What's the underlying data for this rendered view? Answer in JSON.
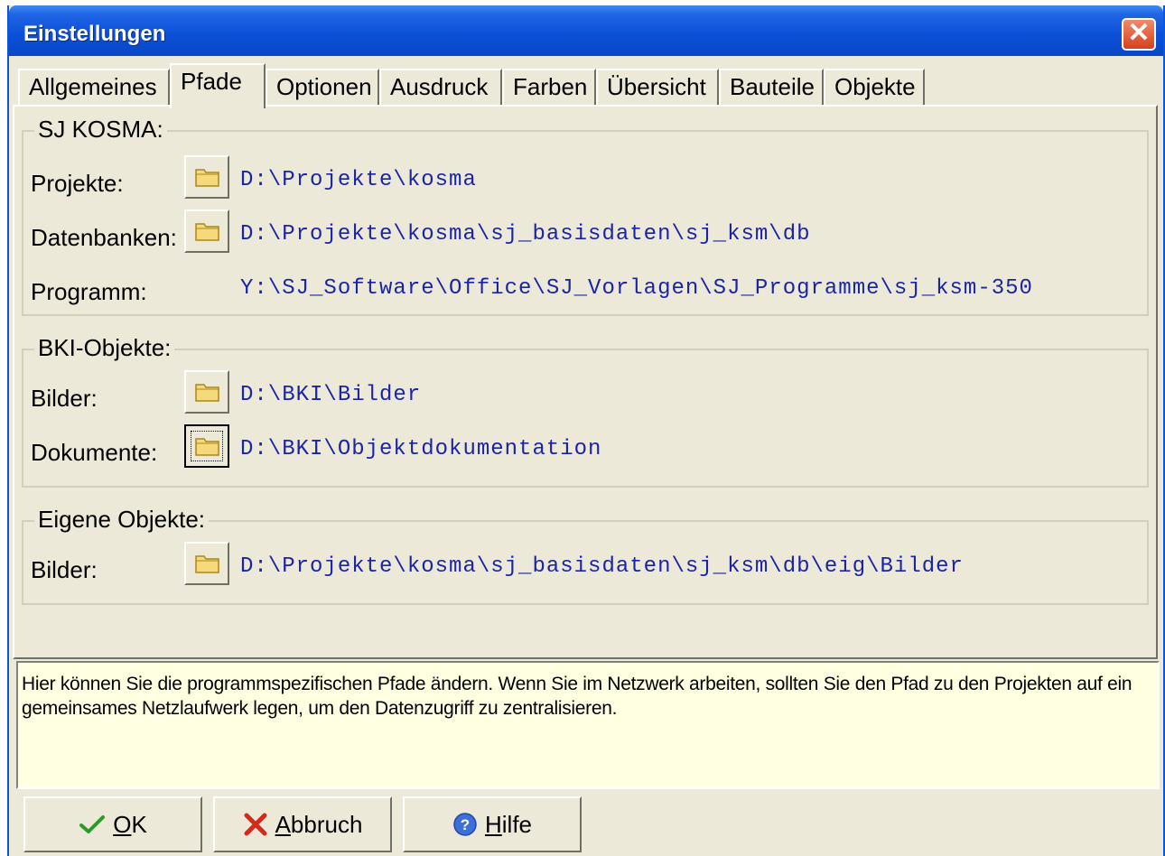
{
  "window": {
    "title": "Einstellungen"
  },
  "tabs": [
    {
      "label": "Allgemeines"
    },
    {
      "label": "Pfade"
    },
    {
      "label": "Optionen"
    },
    {
      "label": "Ausdruck"
    },
    {
      "label": "Farben"
    },
    {
      "label": "Übersicht"
    },
    {
      "label": "Bauteile"
    },
    {
      "label": "Objekte"
    }
  ],
  "active_tab": "Pfade",
  "groups": {
    "kosma": {
      "title": "SJ KOSMA:",
      "rows": [
        {
          "label": "Projekte:",
          "path": "D:\\Projekte\\kosma",
          "has_button": true
        },
        {
          "label": "Datenbanken:",
          "path": "D:\\Projekte\\kosma\\sj_basisdaten\\sj_ksm\\db",
          "has_button": true
        },
        {
          "label": "Programm:",
          "path": "Y:\\SJ_Software\\Office\\SJ_Vorlagen\\SJ_Programme\\sj_ksm-350",
          "has_button": false
        }
      ]
    },
    "bki": {
      "title": "BKI-Objekte:",
      "rows": [
        {
          "label": "Bilder:",
          "path": "D:\\BKI\\Bilder",
          "has_button": true
        },
        {
          "label": "Dokumente:",
          "path": "D:\\BKI\\Objektdokumentation",
          "has_button": true
        }
      ]
    },
    "eigene": {
      "title": "Eigene Objekte:",
      "rows": [
        {
          "label": "Bilder:",
          "path": "D:\\Projekte\\kosma\\sj_basisdaten\\sj_ksm\\db\\eig\\Bilder",
          "has_button": true
        }
      ]
    }
  },
  "info_text": "Hier können Sie die programmspezifischen Pfade ändern. Wenn Sie im Netzwerk arbeiten, sollten Sie den Pfad zu den Projekten auf ein gemeinsames Netzlaufwerk legen, um den Datenzugriff zu zentralisieren.",
  "buttons": {
    "ok": {
      "mnemonic": "O",
      "rest": "K",
      "icon": "checkmark-icon",
      "color": "#2a9a2a"
    },
    "cancel": {
      "mnemonic": "A",
      "rest": "bbruch",
      "icon": "red-x-icon",
      "color": "#d42a1a"
    },
    "help": {
      "mnemonic": "H",
      "rest": "ilfe",
      "icon": "help-icon",
      "color": "#3d6fd6"
    }
  },
  "colors": {
    "path_text": "#1a24a8",
    "title_bar": "#0b4fd7",
    "info_background": "#ffffe1"
  }
}
